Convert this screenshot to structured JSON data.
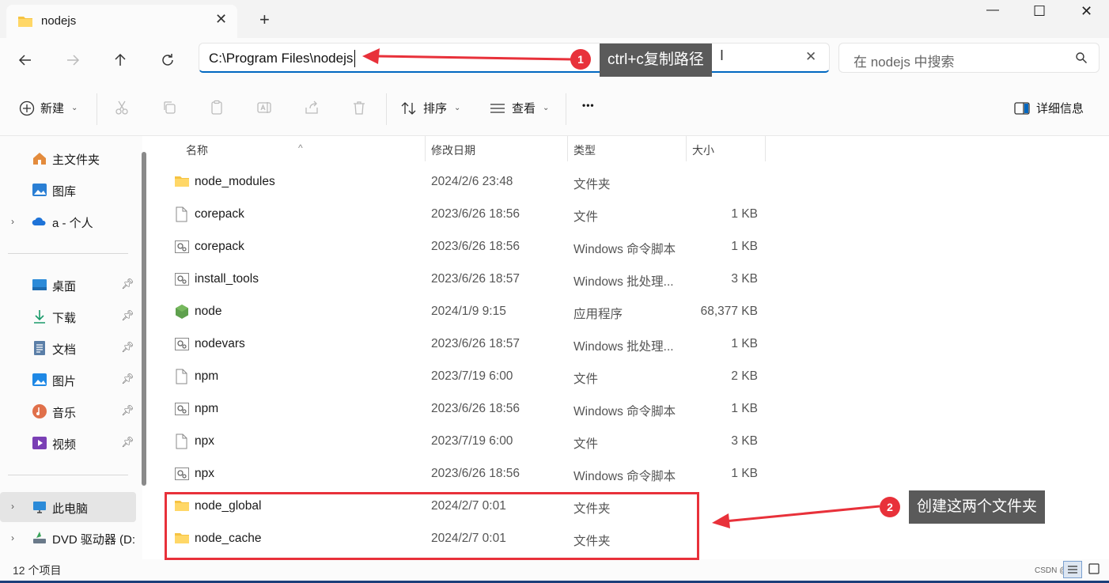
{
  "window": {
    "tab_title": "nodejs",
    "tab_close": "✕",
    "new_tab": "+",
    "minimize": "—",
    "maximize": "☐",
    "close": "✕"
  },
  "nav": {
    "address": "C:\\Program Files\\nodejs",
    "clear": "✕",
    "search_placeholder": "在 nodejs 中搜索"
  },
  "toolbar": {
    "new_label": "新建",
    "sort_label": "排序",
    "view_label": "查看",
    "more_label": "•••",
    "details_label": "详细信息"
  },
  "sidebar": {
    "items": [
      {
        "label": "主文件夹",
        "icon": "home-icon"
      },
      {
        "label": "图库",
        "icon": "gallery-icon"
      },
      {
        "label": "a - 个人",
        "icon": "cloud-icon"
      },
      {
        "label": "桌面",
        "icon": "desktop-icon"
      },
      {
        "label": "下载",
        "icon": "download-icon"
      },
      {
        "label": "文档",
        "icon": "document-icon"
      },
      {
        "label": "图片",
        "icon": "pictures-icon"
      },
      {
        "label": "音乐",
        "icon": "music-icon"
      },
      {
        "label": "视频",
        "icon": "video-icon"
      },
      {
        "label": "此电脑",
        "icon": "pc-icon"
      },
      {
        "label": "DVD 驱动器 (D:",
        "icon": "dvd-icon"
      }
    ]
  },
  "columns": {
    "name": "名称",
    "date": "修改日期",
    "type": "类型",
    "size": "大小"
  },
  "files": [
    {
      "name": "node_modules",
      "date": "2024/2/6 23:48",
      "type": "文件夹",
      "size": "",
      "icon": "folder-icon"
    },
    {
      "name": "corepack",
      "date": "2023/6/26 18:56",
      "type": "文件",
      "size": "1 KB",
      "icon": "file-icon"
    },
    {
      "name": "corepack",
      "date": "2023/6/26 18:56",
      "type": "Windows 命令脚本",
      "size": "1 KB",
      "icon": "script-icon"
    },
    {
      "name": "install_tools",
      "date": "2023/6/26 18:57",
      "type": "Windows 批处理...",
      "size": "3 KB",
      "icon": "script-icon"
    },
    {
      "name": "node",
      "date": "2024/1/9 9:15",
      "type": "应用程序",
      "size": "68,377 KB",
      "icon": "node-icon"
    },
    {
      "name": "nodevars",
      "date": "2023/6/26 18:57",
      "type": "Windows 批处理...",
      "size": "1 KB",
      "icon": "script-icon"
    },
    {
      "name": "npm",
      "date": "2023/7/19 6:00",
      "type": "文件",
      "size": "2 KB",
      "icon": "file-icon"
    },
    {
      "name": "npm",
      "date": "2023/6/26 18:56",
      "type": "Windows 命令脚本",
      "size": "1 KB",
      "icon": "script-icon"
    },
    {
      "name": "npx",
      "date": "2023/7/19 6:00",
      "type": "文件",
      "size": "3 KB",
      "icon": "file-icon"
    },
    {
      "name": "npx",
      "date": "2023/6/26 18:56",
      "type": "Windows 命令脚本",
      "size": "1 KB",
      "icon": "script-icon"
    },
    {
      "name": "node_global",
      "date": "2024/2/7 0:01",
      "type": "文件夹",
      "size": "",
      "icon": "folder-icon"
    },
    {
      "name": "node_cache",
      "date": "2024/2/7 0:01",
      "type": "文件夹",
      "size": "",
      "icon": "folder-icon"
    }
  ],
  "status": {
    "item_count": "12 个项目",
    "watermark": "CSDN @a…"
  },
  "annotations": {
    "badge1": "1",
    "callout1": "ctrl+c复制路径",
    "badge2": "2",
    "callout2": "创建这两个文件夹",
    "color": "#e8313a"
  }
}
